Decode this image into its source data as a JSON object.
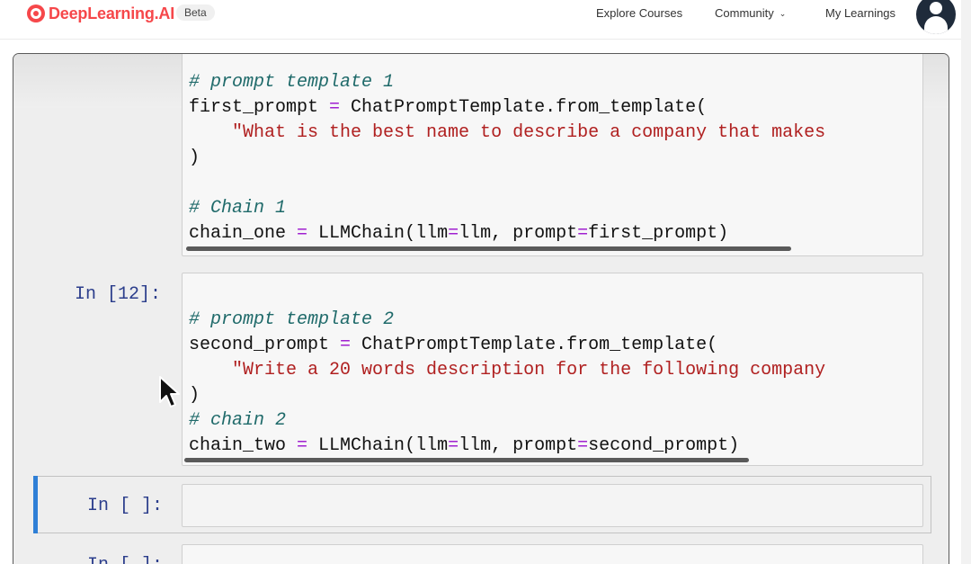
{
  "nav": {
    "logo_text": "DeepLearning.AI",
    "beta_label": "Beta",
    "explore_courses": "Explore Courses",
    "community": "Community",
    "my_learnings": "My Learnings"
  },
  "notebook": {
    "cell1": {
      "comment1": "# prompt template 1",
      "line_assign_var": "first_prompt",
      "line_assign_eq": " = ",
      "line_assign_rhs": "ChatPromptTemplate.from_template(",
      "line_string_indent": "    ",
      "line_string": "\"What is the best name to describe a company that makes",
      "close_paren": ")",
      "comment2": "# Chain 1",
      "chain_var": "chain_one",
      "chain_eq": " = ",
      "chain_call_a": "LLMChain(llm",
      "chain_eq2": "=",
      "chain_call_b": "llm, prompt",
      "chain_eq3": "=",
      "chain_call_c": "first_prompt)"
    },
    "cell2": {
      "prompt_label": "In [12]:",
      "comment1": "# prompt template 2",
      "line_assign_var": "second_prompt",
      "line_assign_eq": " = ",
      "line_assign_rhs": "ChatPromptTemplate.from_template(",
      "line_string_indent": "    ",
      "line_string": "\"Write a 20 words description for the following company",
      "close_paren": ")",
      "comment2": "# chain 2",
      "chain_var": "chain_two",
      "chain_eq": " = ",
      "chain_call_a": "LLMChain(llm",
      "chain_eq2": "=",
      "chain_call_b": "llm, prompt",
      "chain_eq3": "=",
      "chain_call_c": "second_prompt)"
    },
    "cell3": {
      "prompt_label": "In [ ]:"
    },
    "cell4": {
      "prompt_label": "In [ ]:"
    }
  },
  "colors": {
    "brand": "#f6474a",
    "active_cell": "#2f7fd6",
    "comment": "#1f6a6a",
    "operator": "#a020d0",
    "string": "#b02020",
    "prompt": "#2c3e8c"
  },
  "icons": {
    "logo": "deeplearning-logo-icon",
    "community_dropdown": "chevron-down-icon",
    "avatar": "user-avatar-icon",
    "cursor": "mouse-pointer-icon"
  }
}
